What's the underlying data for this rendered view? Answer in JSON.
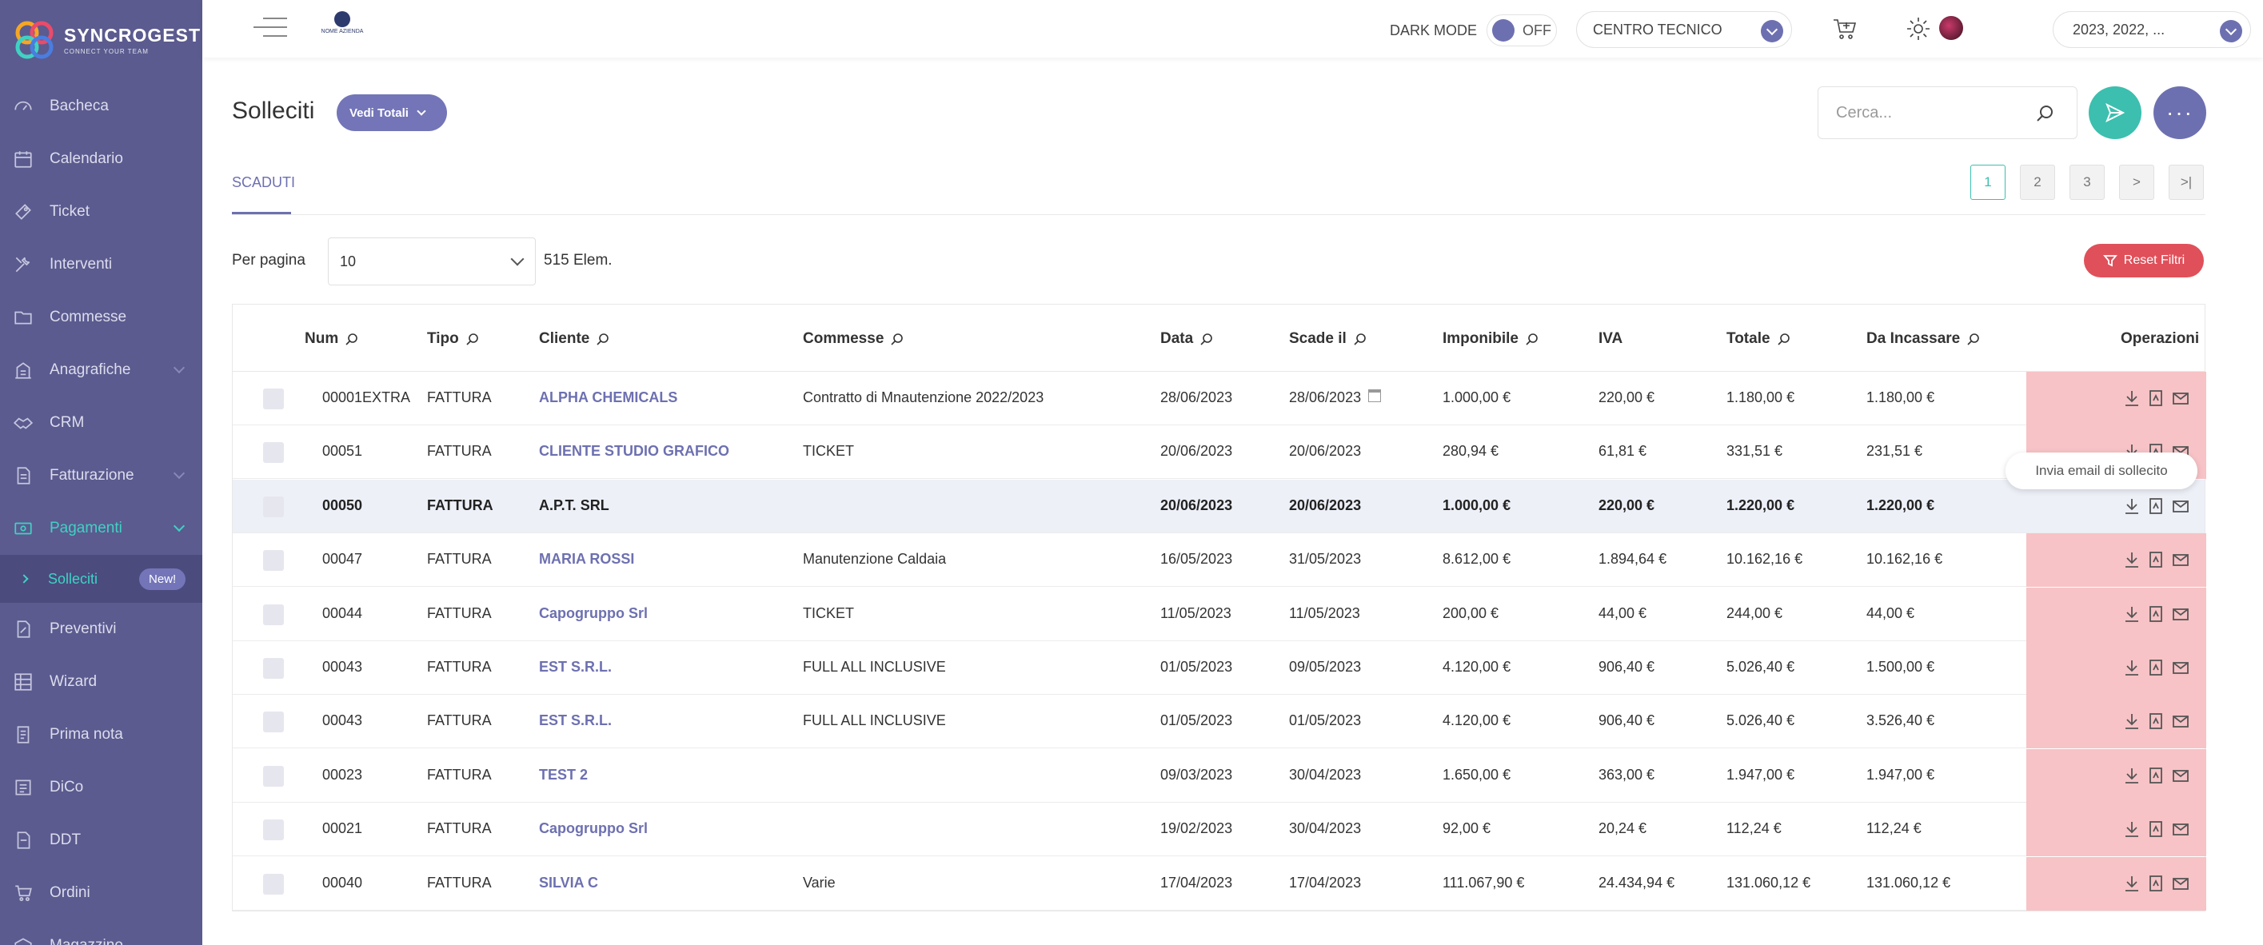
{
  "brand": {
    "name": "SYNCROGEST",
    "tagline": "CONNECT YOUR TEAM",
    "company_logo_text": "NOME AZIENDA"
  },
  "sidebar": {
    "items": [
      {
        "label": "Bacheca",
        "icon": "dashboard-icon"
      },
      {
        "label": "Calendario",
        "icon": "calendar-icon"
      },
      {
        "label": "Ticket",
        "icon": "ticket-icon"
      },
      {
        "label": "Interventi",
        "icon": "tools-icon"
      },
      {
        "label": "Commesse",
        "icon": "folder-icon"
      },
      {
        "label": "Anagrafiche",
        "icon": "building-icon"
      },
      {
        "label": "CRM",
        "icon": "handshake-icon"
      },
      {
        "label": "Fatturazione",
        "icon": "invoice-icon"
      },
      {
        "label": "Pagamenti",
        "icon": "payments-icon"
      },
      {
        "label": "Preventivi",
        "icon": "quote-icon"
      },
      {
        "label": "Wizard",
        "icon": "wizard-icon"
      },
      {
        "label": "Prima nota",
        "icon": "note-icon"
      },
      {
        "label": "DiCo",
        "icon": "dico-icon"
      },
      {
        "label": "DDT",
        "icon": "ddt-icon"
      },
      {
        "label": "Ordini",
        "icon": "cart-icon"
      },
      {
        "label": "Magazzino",
        "icon": "warehouse-icon"
      }
    ],
    "submenu": {
      "label": "Solleciti",
      "badge": "New!"
    }
  },
  "topbar": {
    "dark_mode_label": "DARK MODE",
    "dark_mode_state": "OFF",
    "center_select": "CENTRO TECNICO",
    "year_select": "2023, 2022, ..."
  },
  "page": {
    "title": "Solleciti",
    "totals_button": "Vedi Totali",
    "search_placeholder": "Cerca...",
    "more_label": "···",
    "tab": "SCADUTI",
    "pager": [
      "1",
      "2",
      "3",
      ">",
      ">|"
    ],
    "per_page_label": "Per pagina",
    "per_page_value": "10",
    "element_count": "515 Elem.",
    "reset_filters": "Reset Filtri",
    "tooltip": "Invia email di sollecito"
  },
  "table": {
    "headers": {
      "num": "Num",
      "tipo": "Tipo",
      "cliente": "Cliente",
      "commesse": "Commesse",
      "data": "Data",
      "scade": "Scade il",
      "imponibile": "Imponibile",
      "iva": "IVA",
      "totale": "Totale",
      "da_incassare": "Da Incassare",
      "operazioni": "Operazioni"
    },
    "rows": [
      {
        "num": "00001EXTRA",
        "tipo": "FATTURA",
        "cliente": "ALPHA CHEMICALS",
        "commesse": "Contratto di Mnautenzione 2022/2023",
        "data": "28/06/2023",
        "scade": "28/06/2023",
        "imponibile": "1.000,00 €",
        "iva": "220,00 €",
        "totale": "1.180,00 €",
        "da_incassare": "1.180,00 €"
      },
      {
        "num": "00051",
        "tipo": "FATTURA",
        "cliente": "CLIENTE STUDIO GRAFICO",
        "commesse": "TICKET",
        "data": "20/06/2023",
        "scade": "20/06/2023",
        "imponibile": "280,94 €",
        "iva": "61,81 €",
        "totale": "331,51 €",
        "da_incassare": "231,51 €"
      },
      {
        "num": "00050",
        "tipo": "FATTURA",
        "cliente": "A.P.T. SRL",
        "commesse": "",
        "data": "20/06/2023",
        "scade": "20/06/2023",
        "imponibile": "1.000,00 €",
        "iva": "220,00 €",
        "totale": "1.220,00 €",
        "da_incassare": "1.220,00 €"
      },
      {
        "num": "00047",
        "tipo": "FATTURA",
        "cliente": "MARIA ROSSI",
        "commesse": "Manutenzione Caldaia",
        "data": "16/05/2023",
        "scade": "31/05/2023",
        "imponibile": "8.612,00 €",
        "iva": "1.894,64 €",
        "totale": "10.162,16 €",
        "da_incassare": "10.162,16 €"
      },
      {
        "num": "00044",
        "tipo": "FATTURA",
        "cliente": "Capogruppo Srl",
        "commesse": "TICKET",
        "data": "11/05/2023",
        "scade": "11/05/2023",
        "imponibile": "200,00 €",
        "iva": "44,00 €",
        "totale": "244,00 €",
        "da_incassare": "44,00 €"
      },
      {
        "num": "00043",
        "tipo": "FATTURA",
        "cliente": "EST S.R.L.",
        "commesse": "FULL ALL INCLUSIVE",
        "data": "01/05/2023",
        "scade": "09/05/2023",
        "imponibile": "4.120,00 €",
        "iva": "906,40 €",
        "totale": "5.026,40 €",
        "da_incassare": "1.500,00 €"
      },
      {
        "num": "00043",
        "tipo": "FATTURA",
        "cliente": "EST S.R.L.",
        "commesse": "FULL ALL INCLUSIVE",
        "data": "01/05/2023",
        "scade": "01/05/2023",
        "imponibile": "4.120,00 €",
        "iva": "906,40 €",
        "totale": "5.026,40 €",
        "da_incassare": "3.526,40 €"
      },
      {
        "num": "00023",
        "tipo": "FATTURA",
        "cliente": "TEST 2",
        "commesse": "",
        "data": "09/03/2023",
        "scade": "30/04/2023",
        "imponibile": "1.650,00 €",
        "iva": "363,00 €",
        "totale": "1.947,00 €",
        "da_incassare": "1.947,00 €"
      },
      {
        "num": "00021",
        "tipo": "FATTURA",
        "cliente": "Capogruppo Srl",
        "commesse": "",
        "data": "19/02/2023",
        "scade": "30/04/2023",
        "imponibile": "92,00 €",
        "iva": "20,24 €",
        "totale": "112,24 €",
        "da_incassare": "112,24 €"
      },
      {
        "num": "00040",
        "tipo": "FATTURA",
        "cliente": "SILVIA C",
        "commesse": "Varie",
        "data": "17/04/2023",
        "scade": "17/04/2023",
        "imponibile": "111.067,90 €",
        "iva": "24.434,94 €",
        "totale": "131.060,12 €",
        "da_incassare": "131.060,12 €"
      }
    ]
  },
  "colors": {
    "sidebar": "#5b5b8f",
    "accent": "#6d70b0",
    "teal": "#3cbfae",
    "overdue": "#f7c3c6",
    "danger": "#e0505a"
  }
}
